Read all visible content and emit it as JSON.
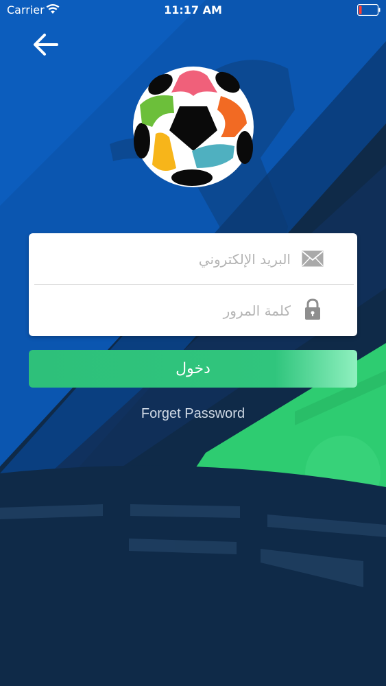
{
  "status_bar": {
    "carrier": "Carrier",
    "time": "11:17 AM",
    "wifi_icon": "wifi-icon",
    "battery_icon": "battery-low-icon"
  },
  "header": {
    "back_icon": "arrow-left-icon"
  },
  "logo": {
    "icon": "soccer-ball-hands-logo"
  },
  "form": {
    "email_placeholder": "البريد الإلكتروني",
    "email_value": "",
    "email_icon": "envelope-icon",
    "password_placeholder": "كلمة المرور",
    "password_value": "",
    "password_icon": "lock-icon"
  },
  "actions": {
    "login_label": "دخول",
    "forget_password_label": "Forget Password"
  },
  "colors": {
    "background_blue": "#0b4ea2",
    "background_navy": "#0f2a48",
    "accent_green": "#2ecc71",
    "button_green": "#30c57d",
    "card_white": "#ffffff"
  }
}
